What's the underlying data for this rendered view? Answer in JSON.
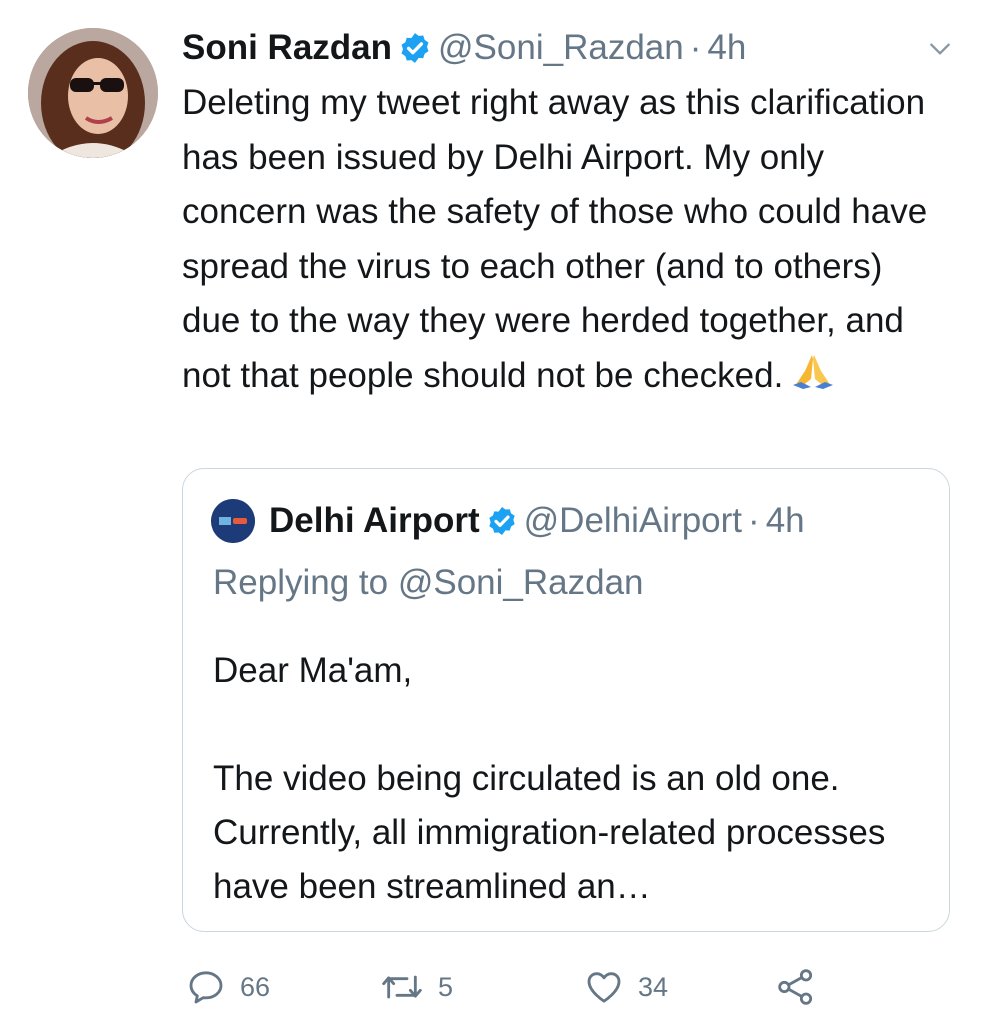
{
  "author": {
    "name": "Soni Razdan",
    "handle": "@Soni_Razdan",
    "separator": "·",
    "time": "4h"
  },
  "tweet": {
    "text": "Deleting my tweet right away as this clarification has been issued by Delhi Airport. My only concern was the safety of those who could have spread the virus to each other (and to others) due to the way they were herded together, and not that people should not be checked.",
    "emoji": "folded-hands"
  },
  "quoted": {
    "name": "Delhi Airport",
    "handle": "@DelhiAirport",
    "separator": "·",
    "time": "4h",
    "replying_prefix": "Replying to",
    "replying_to": "@Soni_Razdan",
    "body": "Dear Ma'am,\n\nThe video being circulated is an old one. Currently, all immigration-related processes have been streamlined an…"
  },
  "actions": {
    "replies": "66",
    "retweets": "5",
    "likes": "34"
  },
  "colors": {
    "verified": "#1da1f2",
    "secondary_text": "#657786",
    "border": "#ccd6dd"
  }
}
